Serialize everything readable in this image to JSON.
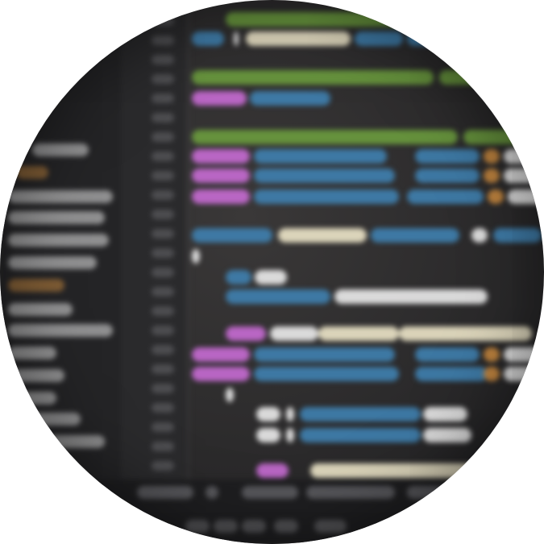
{
  "colors": {
    "background": "#2b2a2b",
    "sidebar": "#242426",
    "keyword_magenta": "#c46ad0",
    "type_blue": "#3f7fae",
    "comment_green": "#6a9a3e",
    "text_white": "#e8e8e8",
    "string_cream": "#e9e2c6",
    "accent_orange": "#c7883f",
    "gutter_number": "#5c5c60"
  },
  "photo": {
    "subject": "blurred-code-editor-screen"
  }
}
